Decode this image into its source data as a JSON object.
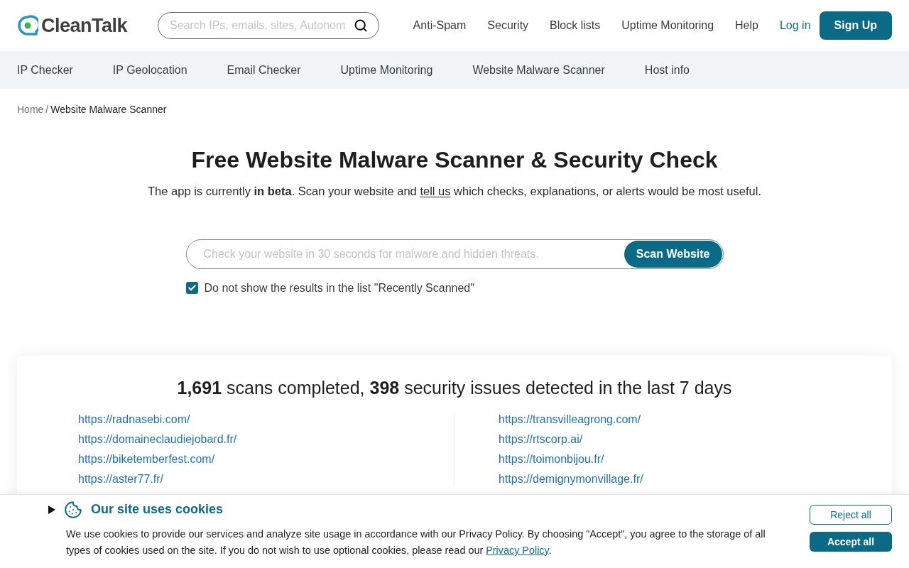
{
  "header": {
    "logo": "CleanTalk",
    "search": {
      "placeholder": "Search IPs, emails, sites, Autonom"
    },
    "nav": [
      "Anti-Spam",
      "Security",
      "Block lists",
      "Uptime Monitoring",
      "Help"
    ],
    "login": "Log in",
    "signup": "Sign Up"
  },
  "subnav": [
    "IP Checker",
    "IP Geolocation",
    "Email Checker",
    "Uptime Monitoring",
    "Website Malware Scanner",
    "Host info"
  ],
  "breadcrumb": {
    "items": [
      "Home",
      "Website Malware Scanner"
    ],
    "separator": "/"
  },
  "hero": {
    "title": "Free Website Malware Scanner & Security Check",
    "subtitle_before": "The app is currently **in beta**. Scan your website and",
    "subtitle_link": "tell us",
    "subtitle_after": "which checks, explanations, or alerts would be most useful."
  },
  "scan": {
    "placeholder": "Check your website in 30 seconds for malware and hidden threats.",
    "button": "Scan Website",
    "hide_option": {
      "label": "Do not show the results in the list \"Recently Scanned\"",
      "checked": true
    }
  },
  "stats": {
    "heading": "**1,691** scans completed, **398** security issues detected in the last 7 days",
    "columns": [
      [
        "https://radnasebi.com/",
        "https://domaineclaudiejobard.fr/",
        "https://biketemberfest.com/",
        "https://aster77.fr/"
      ],
      [
        "https://transvilleagrong.com/",
        "https://rtscorp.ai/",
        "https://toimonbijou.fr/",
        "https://demignymonvillage.fr/"
      ]
    ]
  },
  "cookie_banner": {
    "expanded": false,
    "title": "Our site uses cookies",
    "text_before": "We use cookies to provide our services and analyze site usage in accordance with our Privacy Policy. By choosing \"Accept\", you agree to the storage of all types of cookies used on the site. If you do not wish to use optional cookies, please read our",
    "link": "Privacy Policy",
    "text_after": ".",
    "buttons": [
      {
        "kind": "outline",
        "label": "Reject all"
      },
      {
        "kind": "filled",
        "label": "Accept all"
      }
    ]
  }
}
